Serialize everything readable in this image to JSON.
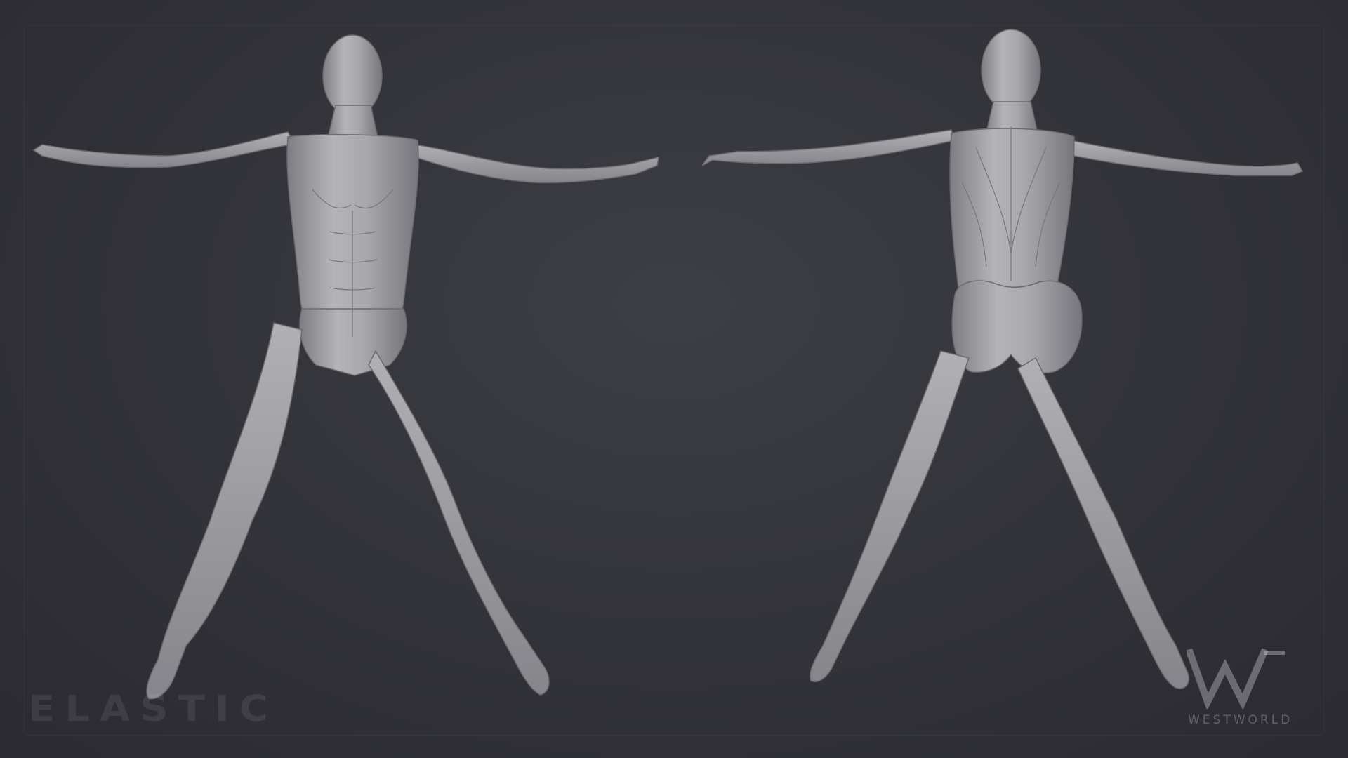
{
  "scene": {
    "background": "#34343b",
    "figure_color": "#a6a6aa",
    "figure_shadow": "#6c6c72"
  },
  "figures": [
    {
      "view": "front"
    },
    {
      "view": "back"
    }
  ],
  "watermarks": {
    "left_text": "ELASTIC",
    "right_text": "WESTWORLD"
  }
}
